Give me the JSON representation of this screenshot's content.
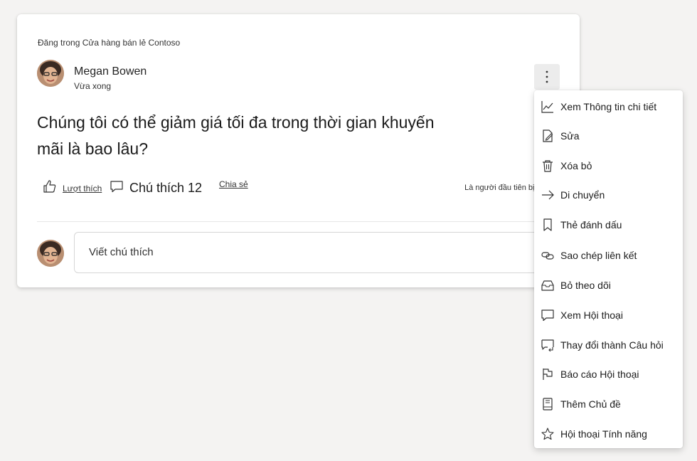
{
  "post": {
    "posted_in": "Đăng trong Cửa hàng bán lẻ Contoso",
    "author_name": "Megan Bowen",
    "timestamp": "Vừa xong",
    "question": "Chúng tôi có thể giảm giá tối đa trong thời gian khuyến mãi là bao lâu?",
    "like_label": "Lượt thích",
    "comment_label": "Chú thích 12",
    "share_label": "Chia sẻ",
    "first_to_react": "Là người đầu tiên bị bệnh"
  },
  "comment_input": {
    "placeholder": "Viết chú thích"
  },
  "menu": {
    "items": [
      {
        "label": "Xem Thông tin chi tiết",
        "icon": "chart-icon"
      },
      {
        "label": "Sửa",
        "icon": "edit-icon"
      },
      {
        "label": "Xóa bỏ",
        "icon": "trash-icon"
      },
      {
        "label": "Di chuyển",
        "icon": "arrow-right-icon"
      },
      {
        "label": "Thẻ đánh dấu",
        "icon": "bookmark-icon"
      },
      {
        "label": "Sao chép liên kết",
        "icon": "link-icon"
      },
      {
        "label": "Bỏ theo dõi",
        "icon": "inbox-icon"
      },
      {
        "label": "Xem Hội thoại",
        "icon": "comment-icon"
      },
      {
        "label": "Thay đổi thành Câu hỏi",
        "icon": "change-question-icon"
      },
      {
        "label": "Báo cáo Hội thoại",
        "icon": "flag-icon"
      },
      {
        "label": "Thêm Chủ đề",
        "icon": "book-icon"
      },
      {
        "label": "Hội thoại Tính năng",
        "icon": "star-icon"
      }
    ]
  }
}
